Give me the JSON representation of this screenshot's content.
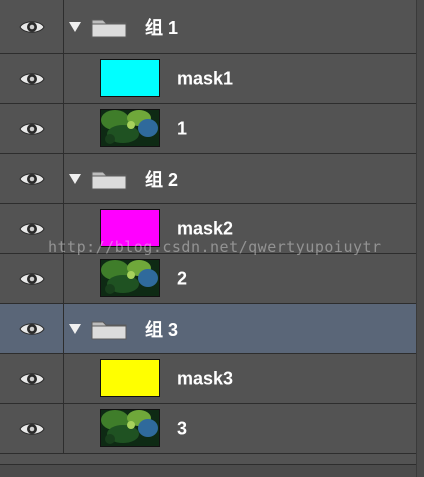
{
  "layers": [
    {
      "kind": "group",
      "name": "组 1",
      "expanded": true,
      "visible": true
    },
    {
      "kind": "mask",
      "name": "mask1",
      "color": "#00ffff",
      "visible": true
    },
    {
      "kind": "image",
      "name": "1",
      "visible": true
    },
    {
      "kind": "group",
      "name": "组 2",
      "expanded": true,
      "visible": true
    },
    {
      "kind": "mask",
      "name": "mask2",
      "color": "#ff00ff",
      "visible": true
    },
    {
      "kind": "image",
      "name": "2",
      "visible": true
    },
    {
      "kind": "group",
      "name": "组 3",
      "expanded": true,
      "visible": true,
      "selected": true
    },
    {
      "kind": "mask",
      "name": "mask3",
      "color": "#ffff00",
      "visible": true
    },
    {
      "kind": "image",
      "name": "3",
      "visible": true
    }
  ],
  "watermark": "http://blog.csdn.net/qwertyupoiuytr",
  "icons": {
    "visibility": "eye-icon",
    "disclosure": "triangle-down-icon",
    "group": "folder-icon"
  },
  "colors": {
    "panel_bg": "#535353",
    "selected_bg": "#5a6678",
    "divider": "#2d2d2d"
  }
}
